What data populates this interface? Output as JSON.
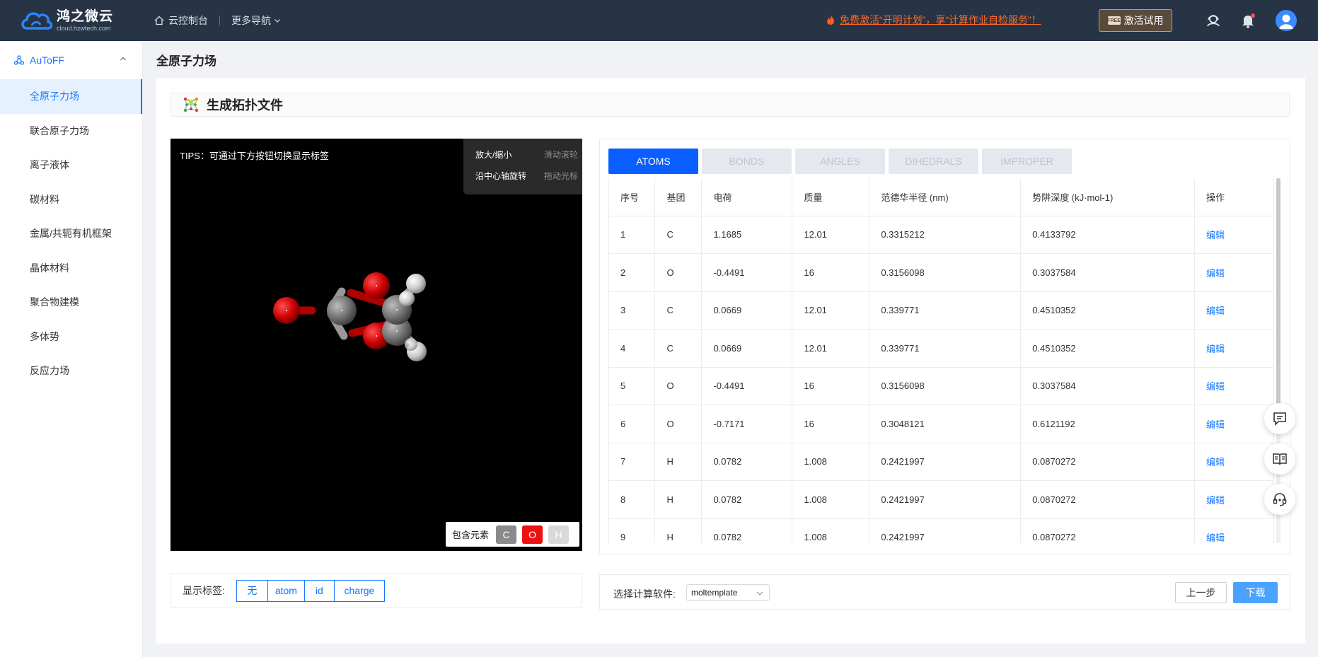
{
  "topbar": {
    "brand_name": "鸿之微云",
    "brand_domain": "cloud.hzwtech.com",
    "console": "云控制台",
    "more_nav": "更多导航",
    "promo": "免费激活“开明计划”，享“计算作业自检服务”！",
    "activate": "激活试用",
    "activate_badge": "FREE"
  },
  "sidebar": {
    "group": "AuToFF",
    "items": [
      {
        "label": "全原子力场",
        "active": true
      },
      {
        "label": "联合原子力场"
      },
      {
        "label": "离子液体"
      },
      {
        "label": "碳材料"
      },
      {
        "label": "金属/共轭有机框架"
      },
      {
        "label": "晶体材料"
      },
      {
        "label": "聚合物建模"
      },
      {
        "label": "多体势"
      },
      {
        "label": "反应力场"
      }
    ]
  },
  "page": {
    "title": "全原子力场",
    "section_title": "生成拓扑文件"
  },
  "viewer": {
    "tips": "TIPS：可通过下方按钮切换显示标签",
    "controls": [
      {
        "key": "放大/缩小",
        "value": "滑动滚轮"
      },
      {
        "key": "沿中心轴旋转",
        "value": "拖动光标"
      }
    ],
    "elements_label": "包含元素",
    "elements": [
      "C",
      "O",
      "H"
    ]
  },
  "tabs": [
    "ATOMS",
    "BONDS",
    "ANGLES",
    "DIHEDRALS",
    "IMPROPER"
  ],
  "table": {
    "headers": [
      "序号",
      "基团",
      "电荷",
      "质量",
      "范德华半径 (nm)",
      "势阱深度 (kJ·mol-1)",
      "操作"
    ],
    "rows": [
      [
        "1",
        "C",
        "1.1685",
        "12.01",
        "0.3315212",
        "0.4133792",
        "编辑"
      ],
      [
        "2",
        "O",
        "-0.4491",
        "16",
        "0.3156098",
        "0.3037584",
        "编辑"
      ],
      [
        "3",
        "C",
        "0.0669",
        "12.01",
        "0.339771",
        "0.4510352",
        "编辑"
      ],
      [
        "4",
        "C",
        "0.0669",
        "12.01",
        "0.339771",
        "0.4510352",
        "编辑"
      ],
      [
        "5",
        "O",
        "-0.4491",
        "16",
        "0.3156098",
        "0.3037584",
        "编辑"
      ],
      [
        "6",
        "O",
        "-0.7171",
        "16",
        "0.3048121",
        "0.6121192",
        "编辑"
      ],
      [
        "7",
        "H",
        "0.0782",
        "1.008",
        "0.2421997",
        "0.0870272",
        "编辑"
      ],
      [
        "8",
        "H",
        "0.0782",
        "1.008",
        "0.2421997",
        "0.0870272",
        "编辑"
      ],
      [
        "9",
        "H",
        "0.0782",
        "1.008",
        "0.2421997",
        "0.0870272",
        "编辑"
      ]
    ]
  },
  "label_bar": {
    "label": "显示标签:",
    "options": [
      "无",
      "atom",
      "id",
      "charge"
    ]
  },
  "software_bar": {
    "label": "选择计算软件:",
    "selected": "moltemplate",
    "prev": "上一步",
    "download": "下载"
  },
  "colors": {
    "accent": "#1677ff",
    "topbar": "#263445",
    "carbon": "#8a8a8a",
    "oxygen": "#ee1111",
    "hydrogen": "#d9d9d9"
  }
}
